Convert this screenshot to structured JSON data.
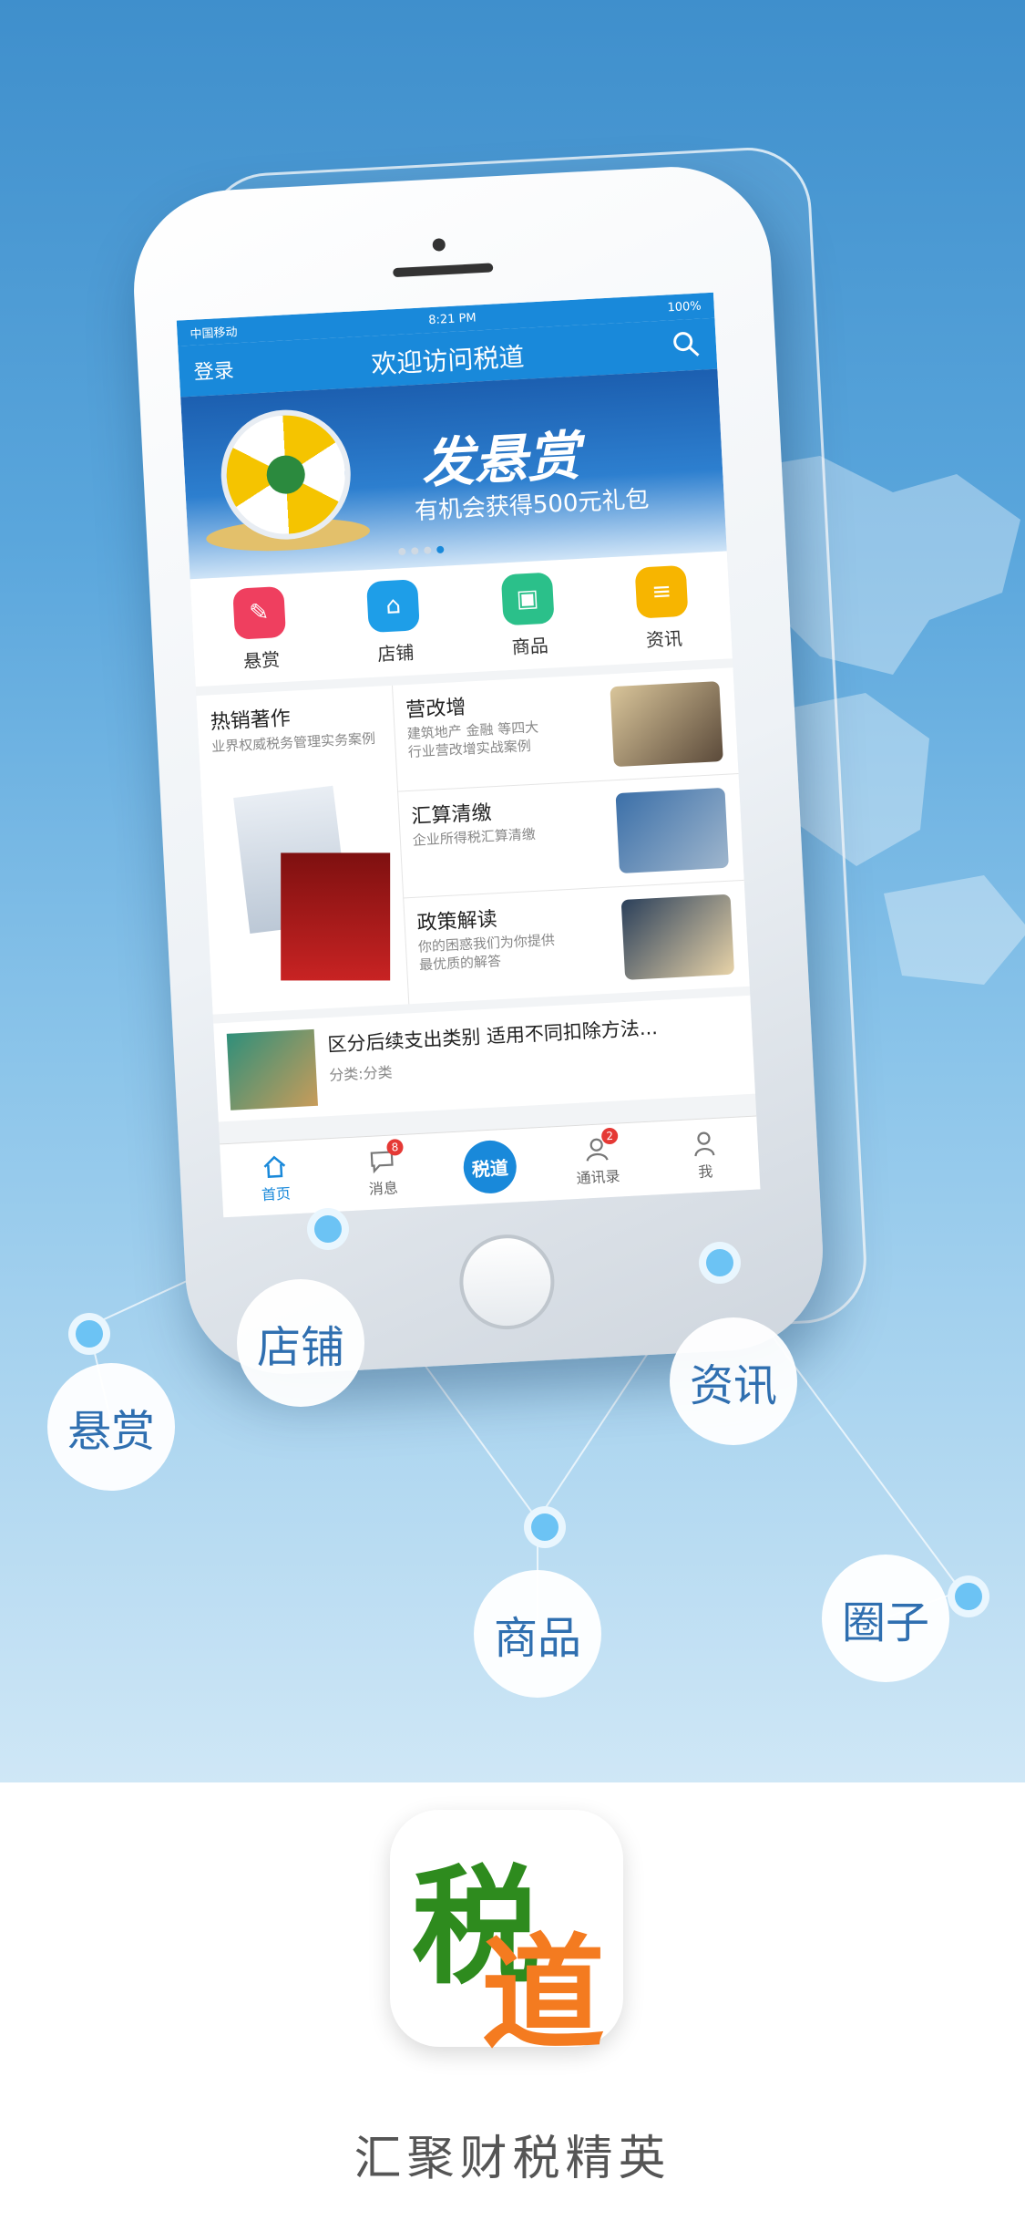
{
  "status": {
    "carrier": "中国移动",
    "time": "8:21 PM",
    "battery": "100%"
  },
  "nav": {
    "login": "登录",
    "title": "欢迎访问税道"
  },
  "banner": {
    "title": "发悬赏",
    "subtitle": "有机会获得500元礼包"
  },
  "categories": [
    {
      "label": "悬赏",
      "color": "#ef3f5f"
    },
    {
      "label": "店铺",
      "color": "#1e9ee8"
    },
    {
      "label": "商品",
      "color": "#2bc08a"
    },
    {
      "label": "资讯",
      "color": "#f7b500"
    }
  ],
  "hot": {
    "title": "热销著作",
    "subtitle": "业界权威税务管理实务案例"
  },
  "tiles": [
    {
      "title": "营改增",
      "desc": "建筑地产 金融 等四大行业营改增实战案例"
    },
    {
      "title": "汇算清缴",
      "desc": "企业所得税汇算清缴"
    },
    {
      "title": "政策解读",
      "desc": "你的困惑我们为你提供最优质的解答"
    }
  ],
  "news": {
    "title": "区分后续支出类别 适用不同扣除方法...",
    "category": "分类:分类"
  },
  "tabs": [
    {
      "label": "首页"
    },
    {
      "label": "消息",
      "badge": "8"
    },
    {
      "label": "税道"
    },
    {
      "label": "通讯录",
      "badge": "2"
    },
    {
      "label": "我"
    }
  ],
  "features": {
    "xuanshang": "悬赏",
    "dianpu": "店铺",
    "shangpin": "商品",
    "zixun": "资讯",
    "quanzi": "圈子"
  },
  "logo": {
    "char1": "税",
    "char2": "道"
  },
  "slogan": "汇聚财税精英"
}
